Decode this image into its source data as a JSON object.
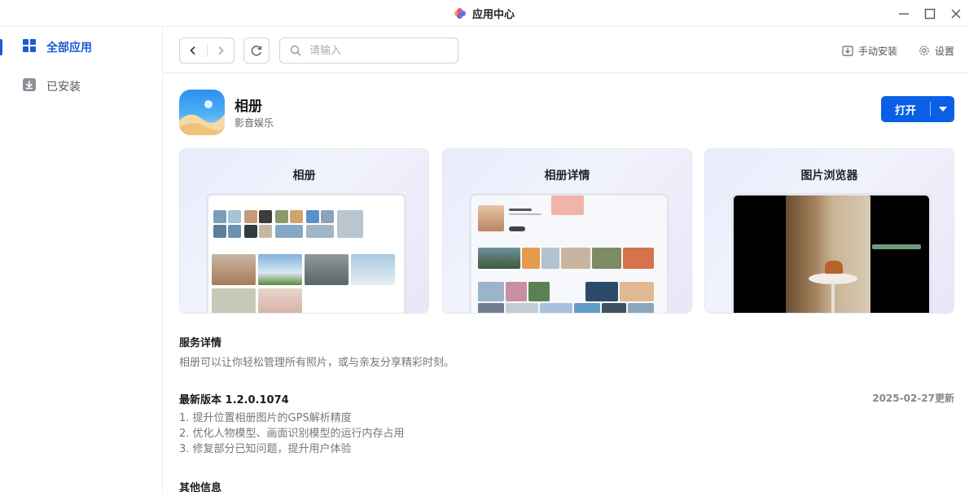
{
  "window": {
    "title": "应用中心",
    "controls": [
      "minimize-icon",
      "maximize-icon",
      "close-icon"
    ]
  },
  "sidebar": {
    "items": [
      {
        "label": "全部应用",
        "icon": "grid-icon",
        "active": true
      },
      {
        "label": "已安装",
        "icon": "download-box-icon",
        "active": false
      }
    ]
  },
  "toolbar": {
    "search_placeholder": "请输入",
    "manual_install": "手动安装",
    "settings": "设置"
  },
  "app": {
    "name": "相册",
    "category": "影音娱乐",
    "open_label": "打开",
    "accent": "#0a5fe6"
  },
  "screenshots": [
    {
      "title": "相册"
    },
    {
      "title": "相册详情"
    },
    {
      "title": "图片浏览器"
    }
  ],
  "service": {
    "title": "服务详情",
    "description": "相册可以让你轻松管理所有照片，或与亲友分享精彩时刻。"
  },
  "version": {
    "title": "最新版本 1.2.0.1074",
    "date": "2025-02-27更新",
    "notes": [
      "1. 提升位置相册图片的GPS解析精度",
      "2. 优化人物模型、画面识别模型的运行内存占用",
      "3. 修复部分已知问题，提升用户体验"
    ]
  },
  "other": {
    "title": "其他信息"
  }
}
